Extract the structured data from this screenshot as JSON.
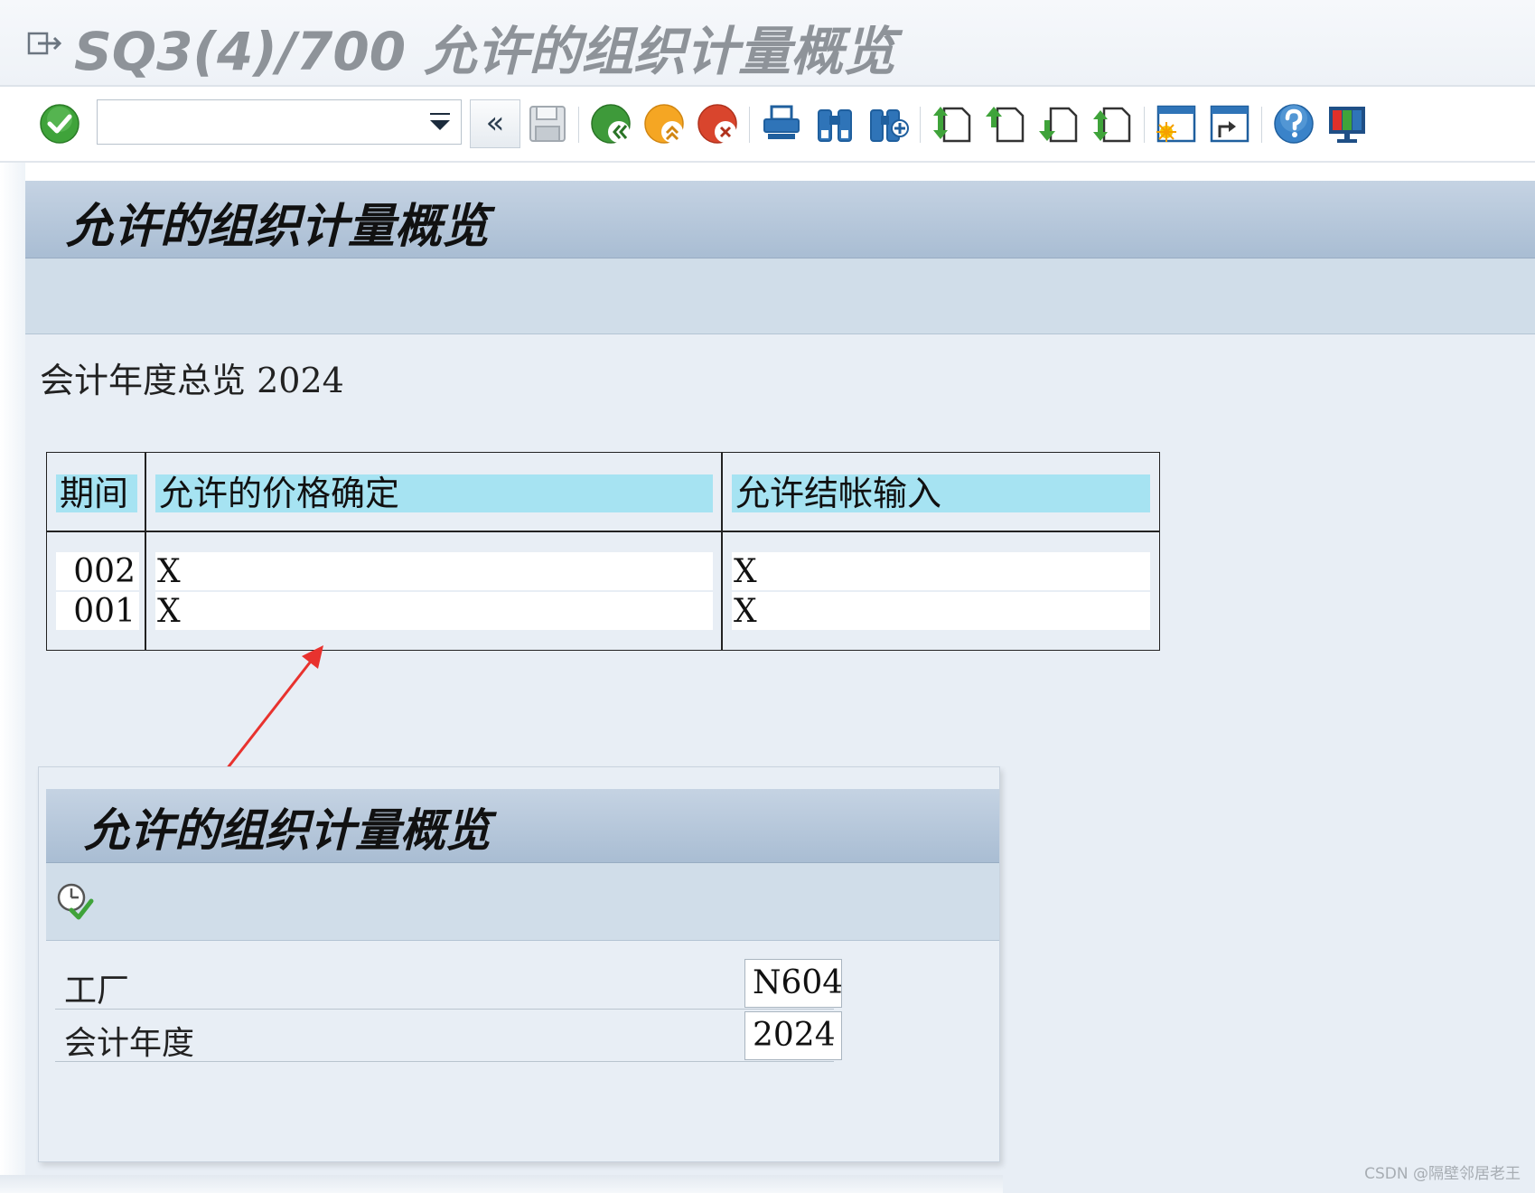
{
  "window": {
    "title": "SQ3(4)/700 允许的组织计量概览"
  },
  "toolbar": {
    "command_field_value": "",
    "back_label": "«",
    "icons": [
      "enter-icon",
      "save-icon",
      "back-icon",
      "exit-icon",
      "cancel-icon",
      "print-icon",
      "find-icon",
      "find-next-icon",
      "first-page-icon",
      "previous-page-icon",
      "next-page-icon",
      "last-page-icon",
      "create-session-icon",
      "shortcut-icon",
      "help-icon",
      "customize-layout-icon"
    ]
  },
  "main": {
    "title": "允许的组织计量概览",
    "fiscal_year_label": "会计年度总览",
    "fiscal_year_value": "2024",
    "table": {
      "columns": [
        "期间",
        "允许的价格确定",
        "允许结帐输入"
      ],
      "rows": [
        {
          "period": "002",
          "price_determination": "X",
          "closing_entry": "X"
        },
        {
          "period": "001",
          "price_determination": "X",
          "closing_entry": "X"
        }
      ]
    }
  },
  "selection_screen": {
    "title": "允许的组织计量概览",
    "fields": [
      {
        "label": "工厂",
        "value": "N604"
      },
      {
        "label": "会计年度",
        "value": "2024"
      }
    ]
  },
  "watermark": "CSDN @隔壁邻居老王",
  "colors": {
    "header_blue": "#a9bdd3",
    "column_header_cyan": "#a6e3f2",
    "panel_background": "#e8eef5",
    "arrow_red": "#e8322e"
  }
}
